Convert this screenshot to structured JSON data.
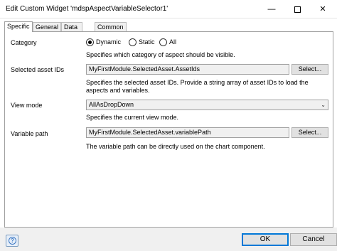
{
  "window": {
    "title": "Edit Custom Widget 'mdspAspectVariableSelector1'",
    "minimize_icon": "minimize-icon",
    "maximize_icon": "maximize-icon",
    "close_icon": "close-icon"
  },
  "tabs": [
    {
      "label": "Specific",
      "active": true
    },
    {
      "label": "General",
      "active": false
    },
    {
      "label": "Data types",
      "active": false
    },
    {
      "label": "Common",
      "active": false
    }
  ],
  "category": {
    "label": "Category",
    "options": [
      {
        "label": "Dynamic",
        "selected": true
      },
      {
        "label": "Static",
        "selected": false
      },
      {
        "label": "All",
        "selected": false
      }
    ],
    "description": "Specifies which category of aspect should be visible."
  },
  "selected_asset_ids": {
    "label": "Selected asset IDs",
    "value": "MyFirstModule.SelectedAsset.AssetIds",
    "button": "Select...",
    "description": "Specifies the selected asset IDs. Provide a string array of asset IDs to load the aspects and variables."
  },
  "view_mode": {
    "label": "View mode",
    "value": "AllAsDropDown",
    "description": "Specifies the current view mode."
  },
  "variable_path": {
    "label": "Variable path",
    "value": "MyFirstModule.SelectedAsset.variablePath",
    "button": "Select...",
    "description": "The variable path can be directly used on the chart component."
  },
  "footer": {
    "ok": "OK",
    "cancel": "Cancel",
    "help_icon": "help-icon"
  },
  "colors": {
    "ok_border": "#0078d7",
    "field_bg": "#f0f0f0",
    "footer_bg": "#f0f0f0"
  }
}
